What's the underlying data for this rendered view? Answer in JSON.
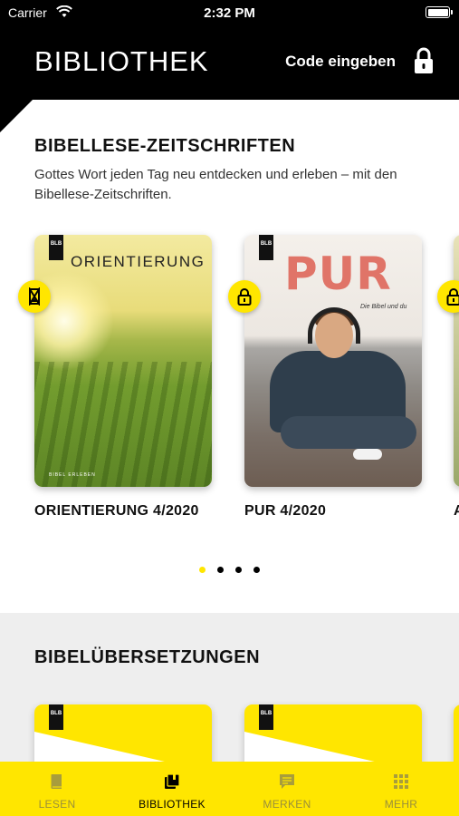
{
  "status_bar": {
    "carrier": "Carrier",
    "time": "2:32 PM"
  },
  "header": {
    "title": "BIBLIOTHEK",
    "code_button": "Code eingeben",
    "lock_icon": "lock-icon"
  },
  "section_magazines": {
    "title": "BIBELLESE-ZEITSCHRIFTEN",
    "description": "Gottes Wort jeden Tag neu entdecken und erleben – mit den Bibellese-Zeitschriften.",
    "items": [
      {
        "cover_title": "ORIENTIERUNG",
        "cover_footer": "BIBEL ERLEBEN",
        "label": "ORIENTIERUNG 4/2020",
        "badge": "hourglass-icon"
      },
      {
        "cover_title": "PUR",
        "cover_subtitle": "Die Bibel und du",
        "label": "PUR 4/2020",
        "badge": "lock-icon"
      },
      {
        "label": "A",
        "badge": "lock-icon"
      }
    ],
    "cover_brand": "BLB",
    "page_indicator": {
      "count": 4,
      "active": 0
    }
  },
  "section_translations": {
    "title": "BIBELÜBERSETZUNGEN",
    "cover_brand": "BLB"
  },
  "tabbar": {
    "items": [
      {
        "label": "LESEN",
        "icon": "book-icon",
        "active": false
      },
      {
        "label": "BIBLIOTHEK",
        "icon": "library-icon",
        "active": true
      },
      {
        "label": "MERKEN",
        "icon": "note-icon",
        "active": false
      },
      {
        "label": "MEHR",
        "icon": "grid-icon",
        "active": false
      }
    ]
  },
  "colors": {
    "accent": "#ffe600",
    "header_bg": "#000000",
    "section_bg": "#eeeeee"
  }
}
